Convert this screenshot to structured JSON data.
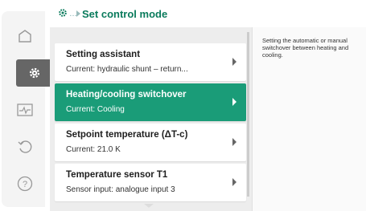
{
  "header": {
    "breadcrumb": "…",
    "title": "Set control mode"
  },
  "nav": {
    "items": [
      {
        "icon": "home-icon",
        "active": false
      },
      {
        "icon": "gear-icon",
        "active": true
      },
      {
        "icon": "diagnostics-icon",
        "active": false
      },
      {
        "icon": "restore-icon",
        "active": false
      },
      {
        "icon": "help-icon",
        "active": false
      }
    ]
  },
  "menu": {
    "items": [
      {
        "title": "Setting assistant",
        "subtitle": "Current: hydraulic shunt – return...",
        "selected": false
      },
      {
        "title": "Heating/cooling switchover",
        "subtitle": "Current: Cooling",
        "selected": true
      },
      {
        "title": "Setpoint temperature (ΔT-c)",
        "subtitle": "Current: 21.0 K",
        "selected": false
      },
      {
        "title": "Temperature sensor T1",
        "subtitle": "Sensor input: analogue input 3",
        "selected": false
      }
    ]
  },
  "help": {
    "text": "Setting the automatic or manual switchover between heating and cooling."
  },
  "colors": {
    "accent": "#1a9c78",
    "title": "#0a7b5c"
  }
}
